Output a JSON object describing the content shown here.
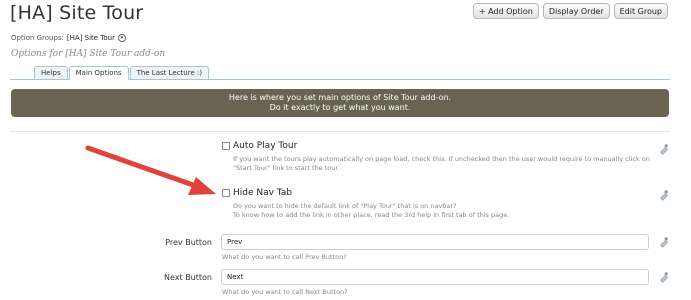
{
  "page": {
    "title": "[HA] Site Tour",
    "subtitle": "Options for [HA] Site Tour add-on",
    "group_label": "Option Groups:",
    "group_value": "[HA] Site Tour"
  },
  "toolbar": {
    "add_option": "+ Add Option",
    "display_order": "Display Order",
    "edit_group": "Edit Group"
  },
  "tabs": [
    {
      "label": "Helps"
    },
    {
      "label": "Main Options"
    },
    {
      "label": "The Last Lecture :)"
    }
  ],
  "banner": {
    "line1": "Here is where you set main options of Site Tour add-on.",
    "line2": "Do it exactly to get what you want."
  },
  "options": {
    "auto_play": {
      "label": "Auto Play Tour",
      "hint1": "If you want the tours play automatically on page load, check this. If unchecked then the user would require to manually click on",
      "hint2": "\"Start Tour\" link to start the tour."
    },
    "hide_nav": {
      "label": "Hide Nav Tab",
      "hint1": "Do you want to hide the default link of \"Play Tour\" that is on navbar?",
      "hint2": "To know how to add the link in other place, read the 3rd help in first tab of this page."
    },
    "prev_button": {
      "label": "Prev Button",
      "value": "Prev",
      "hint": "What do you want to call Prev Button?"
    },
    "next_button": {
      "label": "Next Button",
      "value": "Next",
      "hint": "What do you want to call Next Button?"
    }
  },
  "colors": {
    "banner_bg": "#6a6352",
    "arrow": "#e0433a",
    "tab_border": "#a9c4d6"
  },
  "icons": [
    "dropdown-icon",
    "edit-pencil-icon",
    "annotation-arrow"
  ]
}
